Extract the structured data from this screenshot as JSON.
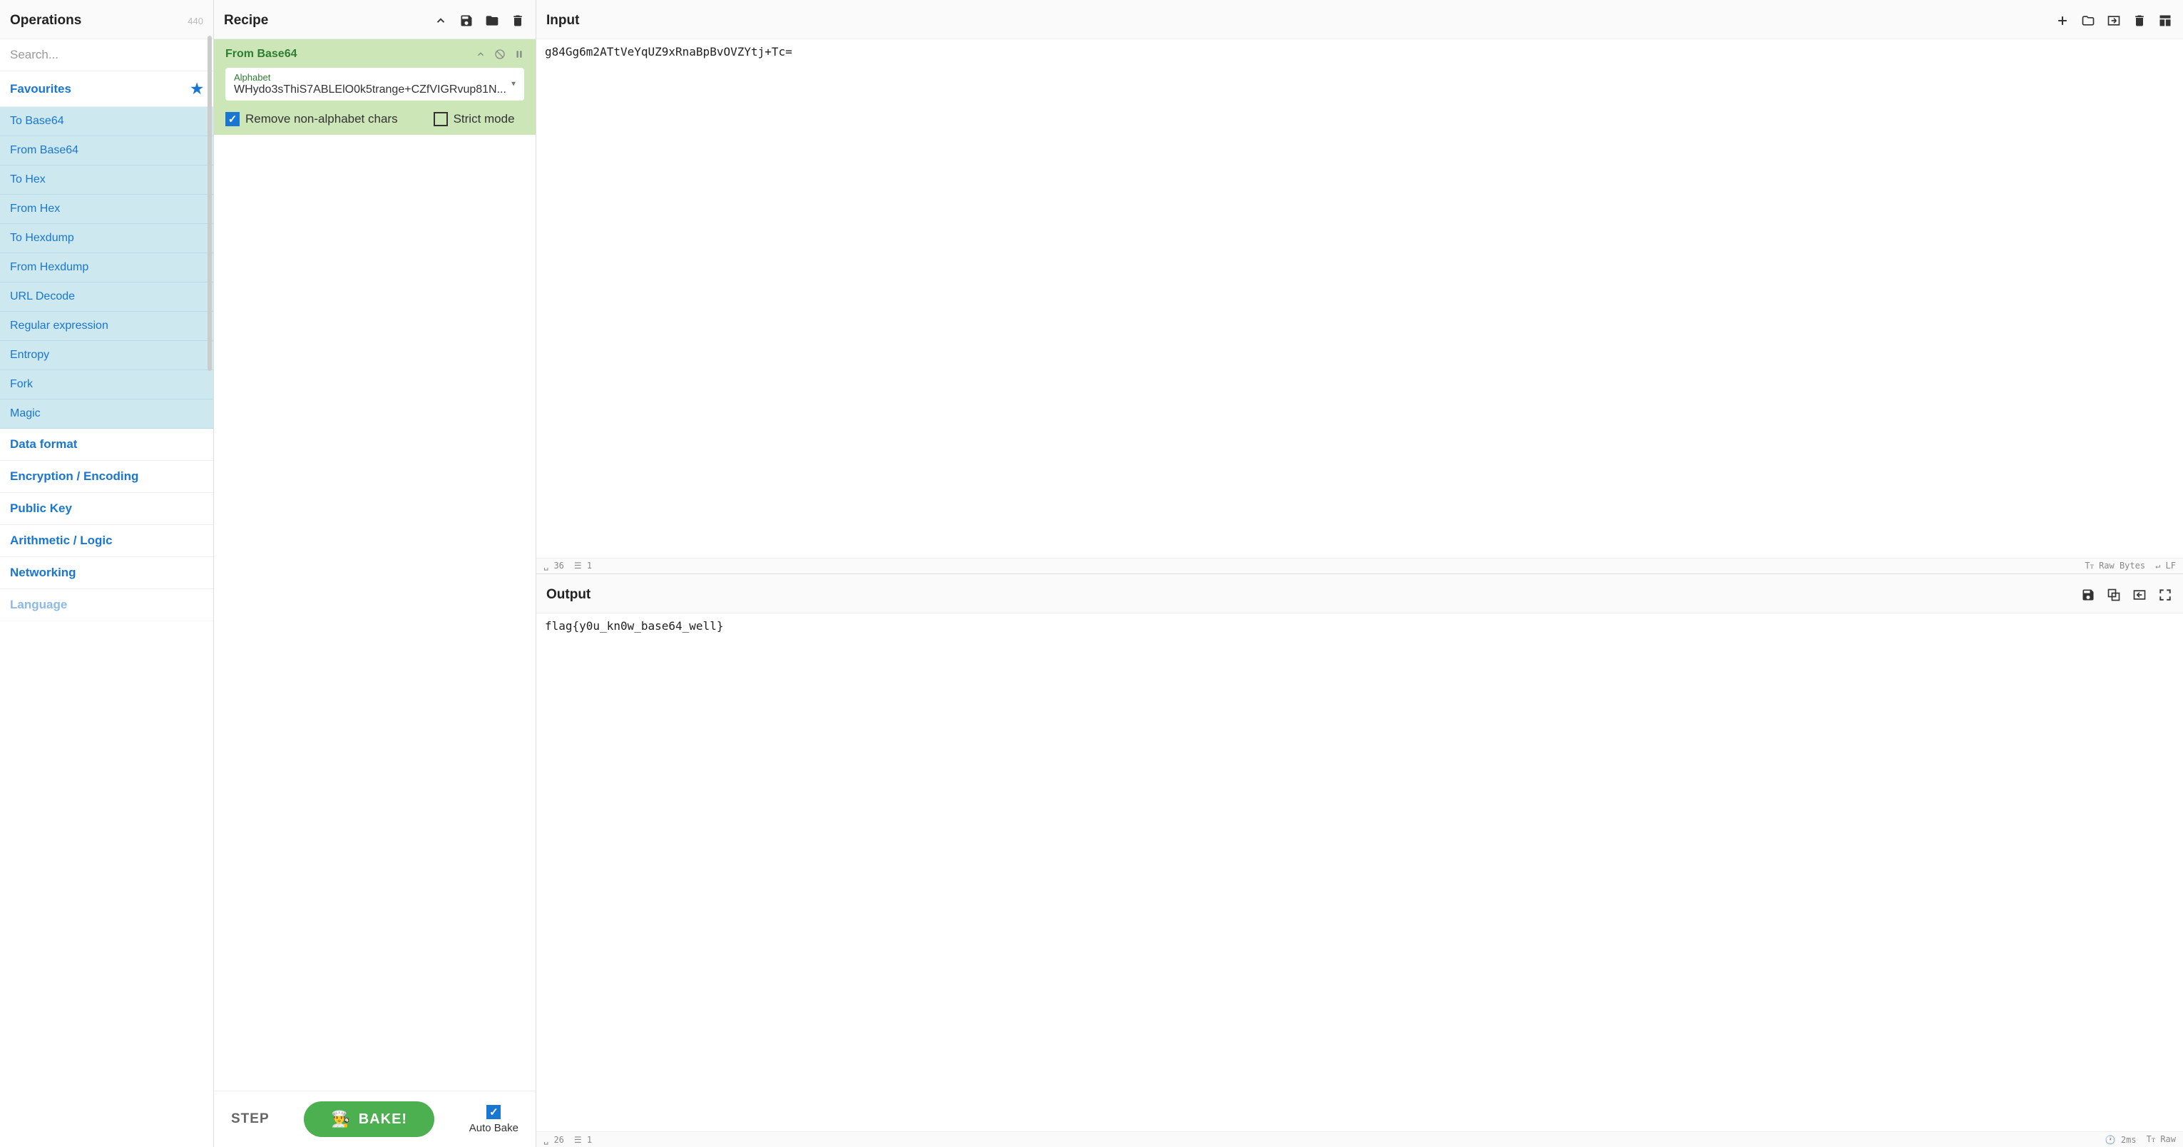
{
  "operations": {
    "title": "Operations",
    "count": "440",
    "search_placeholder": "Search...",
    "favourites_label": "Favourites",
    "favourites": [
      "To Base64",
      "From Base64",
      "To Hex",
      "From Hex",
      "To Hexdump",
      "From Hexdump",
      "URL Decode",
      "Regular expression",
      "Entropy",
      "Fork",
      "Magic"
    ],
    "categories": [
      "Data format",
      "Encryption / Encoding",
      "Public Key",
      "Arithmetic / Logic",
      "Networking",
      "Language"
    ]
  },
  "recipe": {
    "title": "Recipe",
    "operation": {
      "name": "From Base64",
      "alphabet_label": "Alphabet",
      "alphabet_value": "WHydo3sThiS7ABLElO0k5trange+CZfVIGRvup81N...",
      "remove_label": "Remove non-alphabet chars",
      "remove_checked": true,
      "strict_label": "Strict mode",
      "strict_checked": false
    },
    "step_label": "STEP",
    "bake_label": "BAKE!",
    "autobake_label": "Auto Bake",
    "autobake_checked": true
  },
  "input": {
    "title": "Input",
    "content": "g84Gg6m2ATtVeYqUZ9xRnaBpBvOVZYtj+Tc=",
    "status": {
      "chars": "36",
      "lines": "1",
      "enc": "Raw Bytes",
      "eol": "LF"
    }
  },
  "output": {
    "title": "Output",
    "content": "flag{y0u_kn0w_base64_well}",
    "status": {
      "chars": "26",
      "lines": "1",
      "time": "2ms",
      "enc": "Raw"
    }
  }
}
